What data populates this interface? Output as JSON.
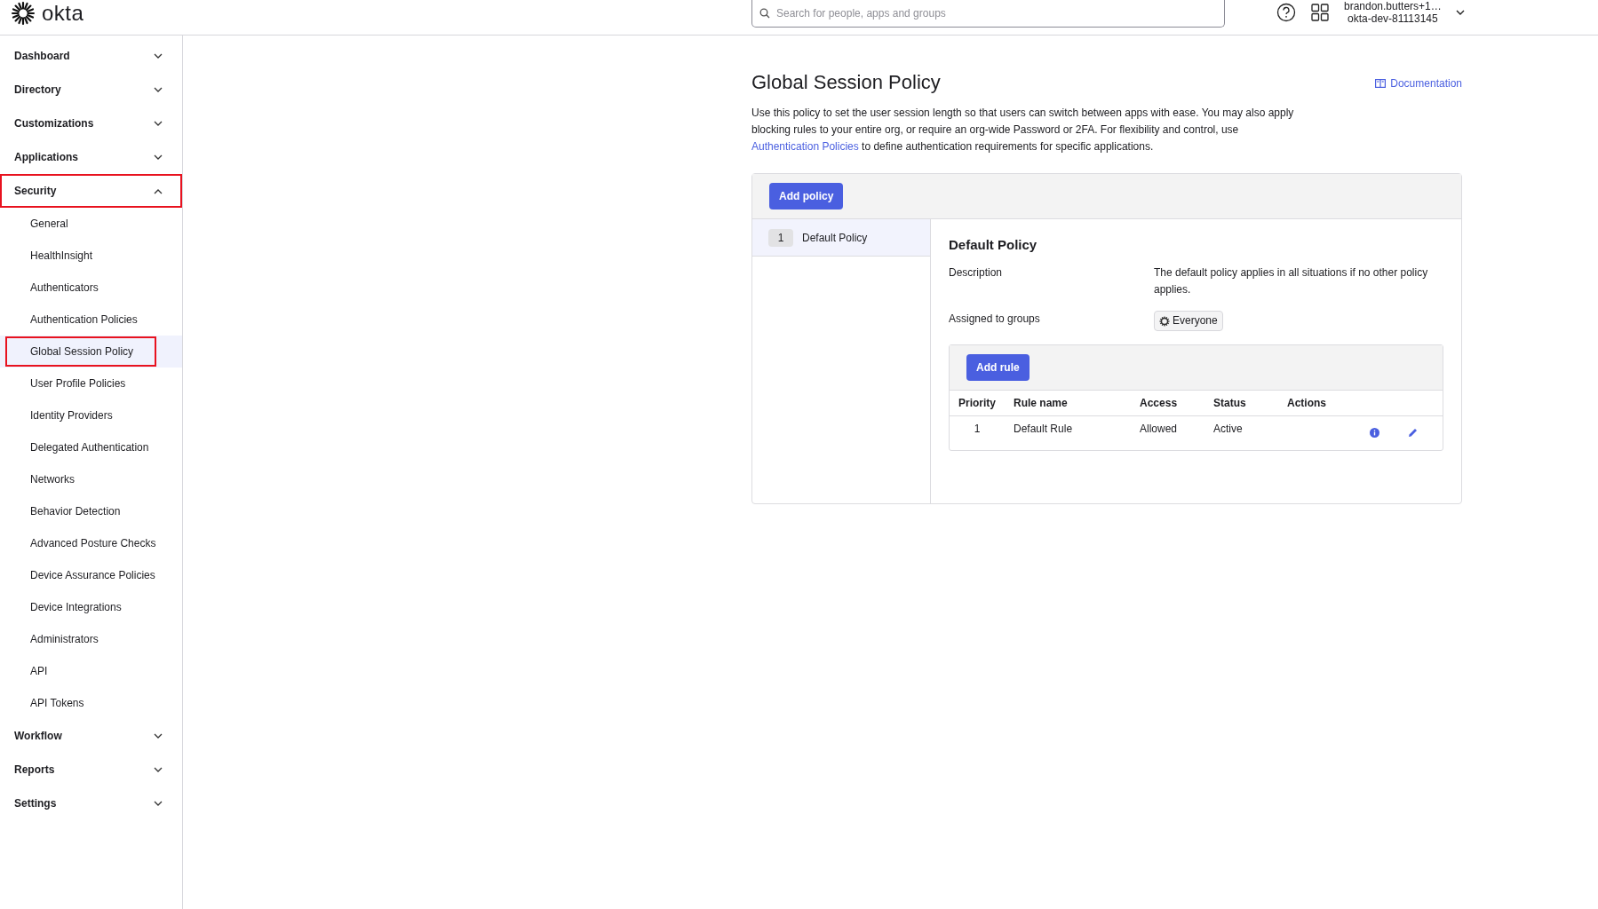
{
  "header": {
    "logo": "okta",
    "search": {
      "placeholder": "Search for people, apps and groups"
    },
    "user": {
      "name": "brandon.butters+1…",
      "org": "okta-dev-81113145"
    }
  },
  "sidebar": {
    "items": [
      {
        "label": "Dashboard",
        "expanded": false,
        "highlighted": false
      },
      {
        "label": "Directory",
        "expanded": false,
        "highlighted": false
      },
      {
        "label": "Customizations",
        "expanded": false,
        "highlighted": false
      },
      {
        "label": "Applications",
        "expanded": false,
        "highlighted": false
      },
      {
        "label": "Security",
        "expanded": true,
        "highlighted": true,
        "children": [
          {
            "label": "General",
            "selected": false,
            "highlighted": false
          },
          {
            "label": "HealthInsight",
            "selected": false,
            "highlighted": false
          },
          {
            "label": "Authenticators",
            "selected": false,
            "highlighted": false
          },
          {
            "label": "Authentication Policies",
            "selected": false,
            "highlighted": false
          },
          {
            "label": "Global Session Policy",
            "selected": true,
            "highlighted": true
          },
          {
            "label": "User Profile Policies",
            "selected": false,
            "highlighted": false
          },
          {
            "label": "Identity Providers",
            "selected": false,
            "highlighted": false
          },
          {
            "label": "Delegated Authentication",
            "selected": false,
            "highlighted": false
          },
          {
            "label": "Networks",
            "selected": false,
            "highlighted": false
          },
          {
            "label": "Behavior Detection",
            "selected": false,
            "highlighted": false
          },
          {
            "label": "Advanced Posture Checks",
            "selected": false,
            "highlighted": false
          },
          {
            "label": "Device Assurance Policies",
            "selected": false,
            "highlighted": false
          },
          {
            "label": "Device Integrations",
            "selected": false,
            "highlighted": false
          },
          {
            "label": "Administrators",
            "selected": false,
            "highlighted": false
          },
          {
            "label": "API",
            "selected": false,
            "highlighted": false
          },
          {
            "label": "API Tokens",
            "selected": false,
            "highlighted": false
          }
        ]
      },
      {
        "label": "Workflow",
        "expanded": false,
        "highlighted": false
      },
      {
        "label": "Reports",
        "expanded": false,
        "highlighted": false
      },
      {
        "label": "Settings",
        "expanded": false,
        "highlighted": false
      }
    ]
  },
  "main": {
    "title": "Global Session Policy",
    "documentation_link": "Documentation",
    "intro": {
      "before": "Use this policy to set the user session length so that users can switch between apps with ease. You may also apply blocking rules to your entire org, or require an org-wide Password or 2FA. For flexibility and control, use",
      "link": "Authentication Policies",
      "after": "to define authentication requirements for specific applications."
    },
    "add_policy_button": "Add policy",
    "policies": [
      {
        "number": "1",
        "name": "Default Policy",
        "selected": true
      }
    ],
    "detail": {
      "title": "Default Policy",
      "fields": [
        {
          "kind": "text",
          "label": "Description",
          "value": "The default policy applies in all situations if no other policy applies."
        },
        {
          "kind": "group",
          "label": "Assigned to groups",
          "value": "Everyone"
        }
      ],
      "add_rule_button": "Add rule",
      "rules_table": {
        "columns": [
          "Priority",
          "Rule name",
          "Access",
          "Status",
          "Actions"
        ],
        "rows": [
          {
            "priority": "1",
            "name": "Default Rule",
            "access": "Allowed",
            "status": "Active"
          }
        ]
      }
    }
  }
}
